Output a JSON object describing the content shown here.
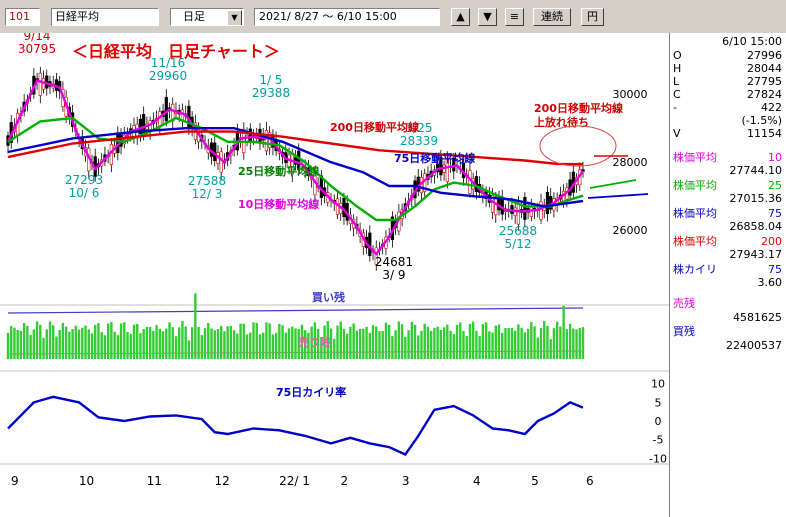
{
  "toolbar": {
    "code": "101",
    "name": "日経平均",
    "period": "日足",
    "range": "2021/ 8/27 ～ 6/10 15:00",
    "up_symbol": "▲",
    "down_symbol": "▼",
    "menu_symbol": "≡",
    "continuous_label": "連続",
    "yen_label": "円"
  },
  "side": {
    "datetime": "6/10 15:00",
    "ohlc": [
      {
        "k": "O",
        "v": "27996"
      },
      {
        "k": "H",
        "v": "28044"
      },
      {
        "k": "L",
        "v": "27795"
      },
      {
        "k": "C",
        "v": "27824"
      },
      {
        "k": "-",
        "v": "422"
      },
      {
        "k": "",
        "v": "(-1.5%)"
      },
      {
        "k": "V",
        "v": "11154"
      }
    ],
    "ma": [
      {
        "label": "株価平均",
        "period": "10",
        "value": "27744.10",
        "color": "#e000e0"
      },
      {
        "label": "株価平均",
        "period": "25",
        "value": "27015.36",
        "color": "#00b000"
      },
      {
        "label": "株価平均",
        "period": "75",
        "value": "26858.04",
        "color": "#0000c8"
      },
      {
        "label": "株価平均",
        "period": "200",
        "value": "27943.17",
        "color": "#e00000"
      }
    ],
    "kairi": {
      "label": "株カイリ",
      "period": "75",
      "value": "3.60"
    },
    "sell": {
      "label": "売残",
      "value": "4581625"
    },
    "buy": {
      "label": "買残",
      "value": "22400537"
    }
  },
  "chart_data": {
    "type": "line",
    "title": "＜日経平均　日足チャート＞",
    "x_month_labels": [
      "9",
      "10",
      "11",
      "12",
      "22/ 1",
      "2",
      "3",
      "4",
      "5",
      "6"
    ],
    "price_axis": {
      "ticks": [
        30000,
        28000,
        26000
      ],
      "range": [
        23800,
        31800
      ]
    },
    "annotations": [
      {
        "lines": [
          "9/14",
          "30795"
        ],
        "value": 30795,
        "color": "#d00000"
      },
      {
        "lines": [
          "27293",
          "10/ 6"
        ],
        "value": 27293,
        "color": "#00a0a0"
      },
      {
        "lines": [
          "11/16",
          "29960"
        ],
        "value": 29960,
        "color": "#00a0a0"
      },
      {
        "lines": [
          "27588",
          "12/ 3"
        ],
        "value": 27588,
        "color": "#00a0a0"
      },
      {
        "lines": [
          "1/ 5",
          "29388"
        ],
        "value": 29388,
        "color": "#00a0a0"
      },
      {
        "lines": [
          "3/25",
          "28339"
        ],
        "value": 28339,
        "color": "#00a0a0"
      },
      {
        "lines": [
          "24681",
          "3/ 9"
        ],
        "value": 24681,
        "color": "#000000"
      },
      {
        "lines": [
          "25688",
          "5/12"
        ],
        "value": 25688,
        "color": "#00a0a0"
      }
    ],
    "line_labels": [
      {
        "text": "200日移動平均線",
        "color": "#d00000"
      },
      {
        "text": "75日移動平均線",
        "color": "#0000c0"
      },
      {
        "text": "25日移動平均線",
        "color": "#008000"
      },
      {
        "text": "10日移動平均線",
        "color": "#e000e0"
      }
    ],
    "callout": [
      "200日移動平均線",
      "上放れ待ち"
    ],
    "series": [
      {
        "name": "10",
        "color": "#e000e0",
        "points": [
          [
            0,
            28600
          ],
          [
            9,
            30400
          ],
          [
            16,
            30200
          ],
          [
            22,
            28700
          ],
          [
            27,
            27800
          ],
          [
            33,
            28400
          ],
          [
            38,
            28900
          ],
          [
            44,
            29100
          ],
          [
            50,
            29550
          ],
          [
            55,
            29400
          ],
          [
            62,
            28400
          ],
          [
            67,
            28000
          ],
          [
            72,
            28700
          ],
          [
            76,
            28750
          ],
          [
            81,
            28700
          ],
          [
            86,
            28100
          ],
          [
            91,
            27950
          ],
          [
            96,
            27300
          ],
          [
            100,
            26900
          ],
          [
            104,
            26600
          ],
          [
            108,
            26100
          ],
          [
            111,
            25600
          ],
          [
            114,
            25300
          ],
          [
            118,
            25800
          ],
          [
            122,
            26500
          ],
          [
            127,
            27300
          ],
          [
            133,
            27800
          ],
          [
            139,
            27900
          ],
          [
            144,
            27400
          ],
          [
            149,
            26900
          ],
          [
            154,
            26600
          ],
          [
            159,
            26550
          ],
          [
            164,
            26600
          ],
          [
            169,
            26800
          ],
          [
            174,
            27200
          ],
          [
            178,
            27744
          ]
        ]
      },
      {
        "name": "25",
        "color": "#00b000",
        "points": [
          [
            0,
            28600
          ],
          [
            10,
            29200
          ],
          [
            20,
            29300
          ],
          [
            28,
            28700
          ],
          [
            36,
            28600
          ],
          [
            44,
            28900
          ],
          [
            52,
            29300
          ],
          [
            60,
            29000
          ],
          [
            68,
            28600
          ],
          [
            76,
            28600
          ],
          [
            84,
            28500
          ],
          [
            92,
            28000
          ],
          [
            100,
            27300
          ],
          [
            108,
            26700
          ],
          [
            114,
            26300
          ],
          [
            120,
            26300
          ],
          [
            126,
            26700
          ],
          [
            132,
            27200
          ],
          [
            138,
            27400
          ],
          [
            145,
            27300
          ],
          [
            152,
            27000
          ],
          [
            160,
            26700
          ],
          [
            168,
            26700
          ],
          [
            174,
            26900
          ],
          [
            178,
            27015
          ]
        ]
      },
      {
        "name": "75",
        "color": "#0000c8",
        "points": [
          [
            0,
            28300
          ],
          [
            20,
            28700
          ],
          [
            40,
            28900
          ],
          [
            55,
            29000
          ],
          [
            70,
            29000
          ],
          [
            85,
            28600
          ],
          [
            100,
            28000
          ],
          [
            110,
            27700
          ],
          [
            118,
            27300
          ],
          [
            126,
            27300
          ],
          [
            134,
            27100
          ],
          [
            144,
            27000
          ],
          [
            156,
            26900
          ],
          [
            166,
            26700
          ],
          [
            178,
            26858
          ]
        ]
      },
      {
        "name": "200",
        "color": "#e00000",
        "points": [
          [
            0,
            28150
          ],
          [
            20,
            28550
          ],
          [
            40,
            28750
          ],
          [
            55,
            28900
          ],
          [
            70,
            28900
          ],
          [
            85,
            28750
          ],
          [
            100,
            28550
          ],
          [
            115,
            28350
          ],
          [
            130,
            28250
          ],
          [
            145,
            28150
          ],
          [
            160,
            28050
          ],
          [
            170,
            27950
          ],
          [
            178,
            27943
          ]
        ]
      }
    ],
    "volume_labels": {
      "buy": "買い残",
      "sell": "売り残"
    },
    "kairi_axis": {
      "ticks": [
        10,
        5,
        0,
        -5,
        -10
      ],
      "range": [
        -11,
        11
      ]
    },
    "kairi_label": "75日カイリ率",
    "kairi_series": [
      [
        0,
        -2
      ],
      [
        8,
        5
      ],
      [
        14,
        6.5
      ],
      [
        22,
        5
      ],
      [
        28,
        1
      ],
      [
        36,
        0
      ],
      [
        44,
        1.2
      ],
      [
        52,
        1.5
      ],
      [
        60,
        0.5
      ],
      [
        64,
        -3
      ],
      [
        68,
        -3.5
      ],
      [
        76,
        -2
      ],
      [
        84,
        -2.5
      ],
      [
        92,
        -4
      ],
      [
        100,
        -6
      ],
      [
        106,
        -4.5
      ],
      [
        112,
        -6
      ],
      [
        118,
        -7
      ],
      [
        123,
        -9
      ],
      [
        127,
        -4
      ],
      [
        132,
        3
      ],
      [
        138,
        4
      ],
      [
        144,
        1.5
      ],
      [
        150,
        -2
      ],
      [
        155,
        -2.5
      ],
      [
        160,
        -3.5
      ],
      [
        164,
        0
      ],
      [
        169,
        2
      ],
      [
        174,
        5
      ],
      [
        178,
        3.6
      ]
    ]
  }
}
